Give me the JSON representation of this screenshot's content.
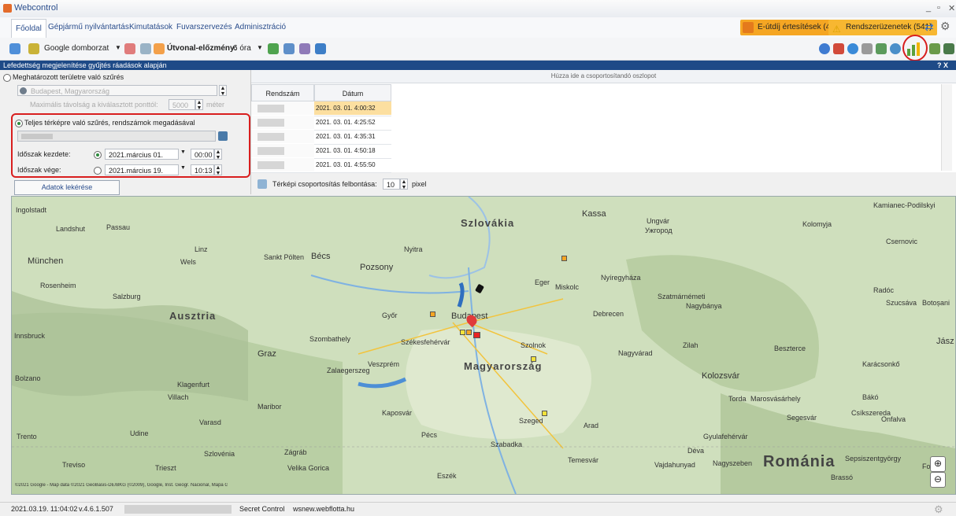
{
  "window": {
    "title": "Webcontrol"
  },
  "menu": {
    "items": [
      "Főoldal",
      "Gépjármű nyilvántartás",
      "Kimutatások",
      "Fuvarszervezés",
      "Adminisztráció"
    ],
    "notif_etoll": "E-útdíj értesítések (4)",
    "notif_system": "Rendszerüzenetek (541)"
  },
  "toolbar": {
    "map_type": "Google domborzat",
    "route_history_label": "Útvonal-előzmény:",
    "route_history_value": "6 óra"
  },
  "panel": {
    "header": "Lefedettség megjelenítése gyűjtés ráadások alapján",
    "help": "? X"
  },
  "filter": {
    "area_radio": "Meghatározott területre való szűrés",
    "area_value": "Budapest, Magyarország",
    "max_distance_label": "Maximális távolság a kiválasztott ponttól:",
    "max_distance_value": "5000",
    "max_distance_unit": "méter",
    "full_map_radio": "Teljes térképre való szűrés, rendszámok megadásával",
    "start_label": "Időszak kezdete:",
    "start_date": "2021.március 01.",
    "start_time": "00:00",
    "end_label": "Időszak vége:",
    "end_date": "2021.március 19.",
    "end_time": "10:13",
    "get_data_button": "Adatok lekérése"
  },
  "grid": {
    "group_hint": "Húzza ide a csoportosítandó oszlopot",
    "columns": [
      "Rendszám",
      "Dátum"
    ],
    "rows": [
      {
        "date": "2021. 03. 01. 4:00:32"
      },
      {
        "date": "2021. 03. 01. 4:25:52"
      },
      {
        "date": "2021. 03. 01. 4:35:31"
      },
      {
        "date": "2021. 03. 01. 4:50:18"
      },
      {
        "date": "2021. 03. 01. 4:55:50"
      }
    ],
    "resolution_label": "Térképi csoportosítás felbontása:",
    "resolution_value": "10",
    "resolution_unit": "pixel"
  },
  "map": {
    "countries": [
      "Szlovákia",
      "Ausztria",
      "Magyarország",
      "Románia"
    ],
    "cities": [
      "Ingolstadt",
      "Landshut",
      "Passau",
      "München",
      "Wels",
      "Linz",
      "Rosenheim",
      "Salzburg",
      "Innsbruck",
      "Bécs",
      "Sankt Pölten",
      "Pozsony",
      "Nyitra",
      "Kassa",
      "Miskolc",
      "Eger",
      "Nyíregyháza",
      "Győr",
      "Budapest",
      "Debrecen",
      "Szatmárnémeti",
      "Nagybánya",
      "Szombathely",
      "Graz",
      "Székesfehérvár",
      "Szolnok",
      "Veszprém",
      "Zalaegerszeg",
      "Nagyvárad",
      "Kolozsvár",
      "Klagenfurt",
      "Villach",
      "Maribor",
      "Kaposvár",
      "Szeged",
      "Arad",
      "Pécs",
      "Zágráb",
      "Szlovénia",
      "Temesvár",
      "Eszék",
      "Szabadka",
      "Brassó",
      "Bolzano",
      "Trento",
      "Udine",
      "Treviso",
      "Trieszt",
      "Velika Gorica",
      "Torda",
      "Marosvásárhely",
      "Déva",
      "Nagyszeben",
      "Gyulafehérvár",
      "Bákó",
      "Csíkszereda",
      "Szucsáva",
      "Botoșani",
      "Kamianec-Podilskyi",
      "Ungvár",
      "Ужгород",
      "Kolomyja",
      "Csernovic",
      "Beszterce",
      "Karácsonkő",
      "Radóc",
      "Zilah",
      "Jász",
      "Nagybánya",
      "Varasd",
      "Segesvár",
      "Onfalva",
      "Fok",
      "Sepsiszentgyörgy",
      "Vajdahunyad"
    ],
    "attribution": "©2021 Google - Map data ©2021 GeoBasis-DE/BKG (©2009), Google, Inst. Geogr. Nacional, Mapa GISrael, ORION-ME, Velence, Atlas. Imagery ©2021 TerraMetrics",
    "zoom_in": "⊕",
    "zoom_out": "⊖"
  },
  "status": {
    "datetime": "2021.03.19. 11:04:02",
    "version": "v.4.6.1.507",
    "company": "Secret Control",
    "host": "wsnew.webflotta.hu"
  },
  "colors": {
    "header_blue": "#1e4a87",
    "highlight_red": "#d81e1e",
    "selected_row": "#fcdfa0",
    "accent_orange": "#f5a623"
  }
}
